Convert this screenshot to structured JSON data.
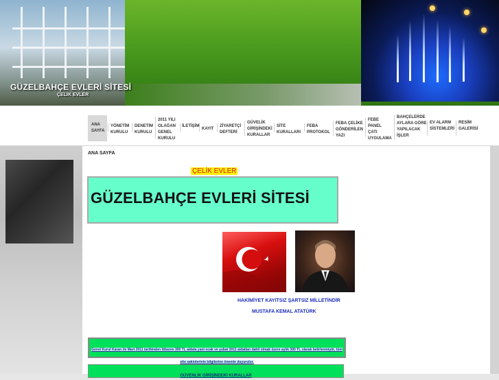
{
  "header": {
    "site_title": "GÜZELBAHÇE EVLERİ SİTESİ",
    "site_subtitle": "ÇELİK EVLER"
  },
  "nav": {
    "items": [
      {
        "label": "ANA SAYFA",
        "active": true
      },
      {
        "label": "YÖNETİM KURULU"
      },
      {
        "label": "DENETİM KURULU"
      },
      {
        "label": "2011 YILI OLAĞAN GENEL KURULU"
      },
      {
        "label": "İLETİŞİM"
      },
      {
        "label": "KAYIT"
      },
      {
        "label": "ZİYARETÇİ DEFTERİ"
      },
      {
        "label": "GÜVELİK GİRİŞİNDEKİ KURALLAR"
      },
      {
        "label": "SİTE KURALLARI"
      },
      {
        "label": "FEBA PROTOKOL"
      },
      {
        "label": "FEBA ÇELİKE GÖNDERİLEN YAZI"
      },
      {
        "label": "FEBE PANEL ÇATI UYGULAMA"
      },
      {
        "label": "BAHÇELERDE AYLARA GÖRE YAPILACAK İŞLER"
      },
      {
        "label": "EV ALARM SİSTEMLERİ"
      },
      {
        "label": "RESİM GALERİSİ"
      }
    ]
  },
  "content": {
    "breadcrumb": "ANA SAYFA",
    "highlight_title": "ÇELİK EVLER",
    "banner_title": "GÜZELBAHÇE EVLERİ SİTESİ",
    "motto": "HAKİMİYET KAYITSIZ ŞARTSIZ MİLLETİNDİR",
    "motto_author": "MUSTAFA KEMAL ATATÜRK",
    "notice": "Genel Kurul Kararı ile Mart 2011 tarihinden itibaren 300 TL aidata yani ocak ve şubat 2011 aidatları dahil olmak üzere aylık 300 TL olarak belirlenmiştir, tüm site sakinlerinin bilgilerine önemle duyurulur.",
    "bottom_link": "GÜVENLİK GİRİŞİNDEKİ KURALLAR"
  },
  "colors": {
    "header_green": "#4a9b1e",
    "banner_bg": "#66ffcc",
    "notice_bg": "#00e05a",
    "link_blue": "#1d2fbd",
    "highlight_yellow": "#ffef00",
    "highlight_red": "#d01a1a"
  }
}
